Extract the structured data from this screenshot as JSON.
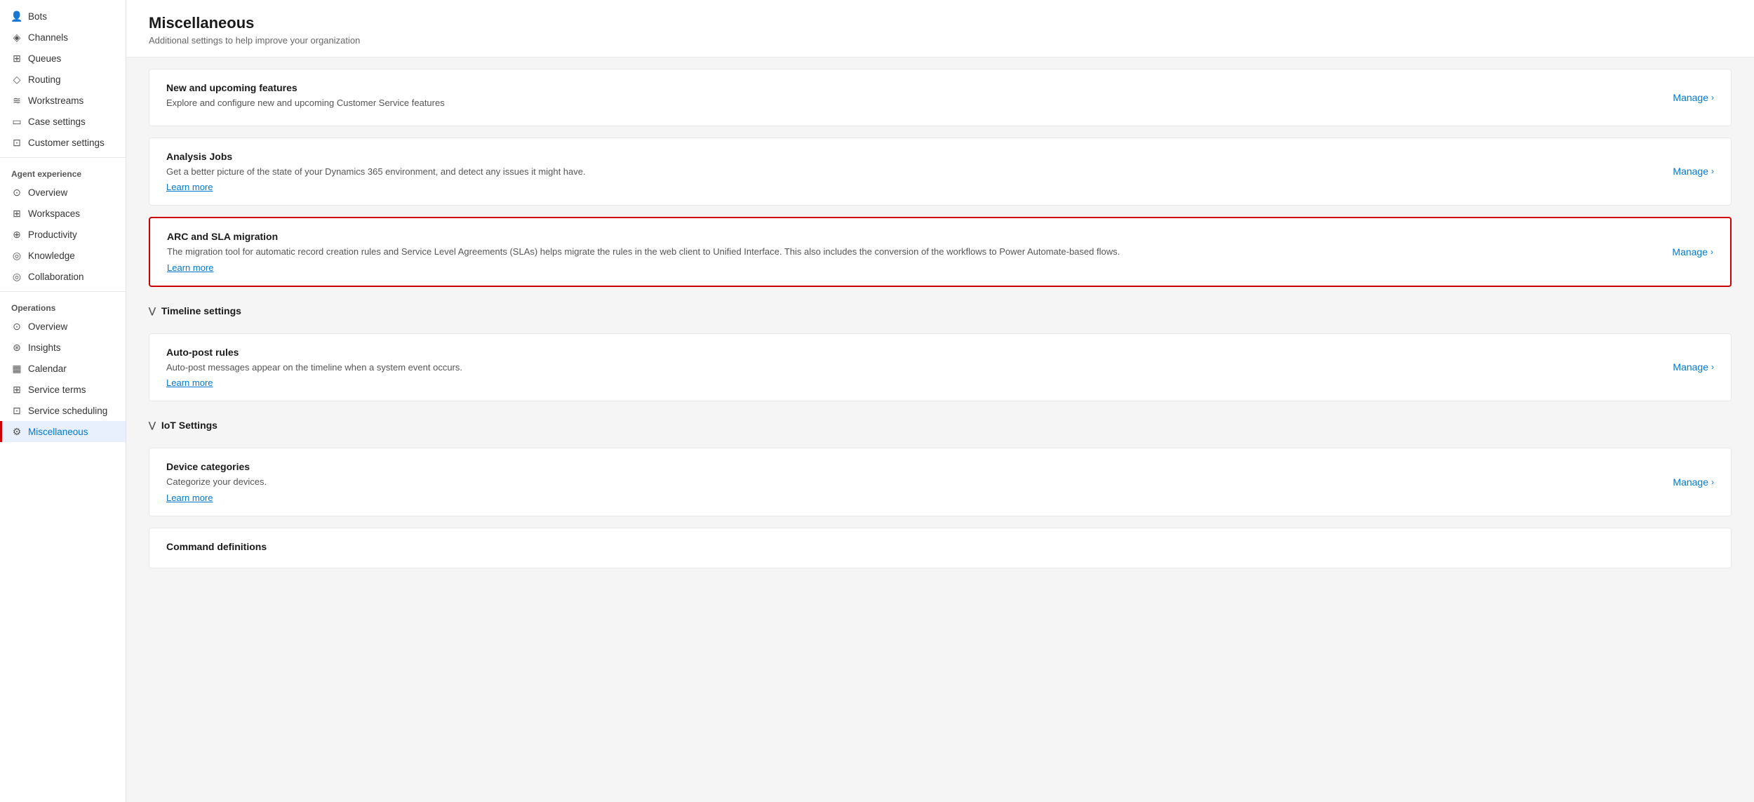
{
  "sidebar": {
    "sections": [
      {
        "name": "",
        "items": [
          {
            "id": "bots",
            "label": "Bots",
            "icon": "👤",
            "active": false
          },
          {
            "id": "channels",
            "label": "Channels",
            "icon": "◈",
            "active": false
          },
          {
            "id": "queues",
            "label": "Queues",
            "icon": "⊞",
            "active": false
          },
          {
            "id": "routing",
            "label": "Routing",
            "icon": "◇",
            "active": false
          },
          {
            "id": "workstreams",
            "label": "Workstreams",
            "icon": "≋",
            "active": false
          },
          {
            "id": "case-settings",
            "label": "Case settings",
            "icon": "▭",
            "active": false
          },
          {
            "id": "customer-settings",
            "label": "Customer settings",
            "icon": "⊡",
            "active": false
          }
        ]
      },
      {
        "name": "Agent experience",
        "items": [
          {
            "id": "ae-overview",
            "label": "Overview",
            "icon": "⊙",
            "active": false
          },
          {
            "id": "ae-workspaces",
            "label": "Workspaces",
            "icon": "⊞",
            "active": false
          },
          {
            "id": "ae-productivity",
            "label": "Productivity",
            "icon": "⊕",
            "active": false
          },
          {
            "id": "ae-knowledge",
            "label": "Knowledge",
            "icon": "◎",
            "active": false
          },
          {
            "id": "ae-collaboration",
            "label": "Collaboration",
            "icon": "◎",
            "active": false
          }
        ]
      },
      {
        "name": "Operations",
        "items": [
          {
            "id": "op-overview",
            "label": "Overview",
            "icon": "⊙",
            "active": false
          },
          {
            "id": "op-insights",
            "label": "Insights",
            "icon": "⊛",
            "active": false
          },
          {
            "id": "op-calendar",
            "label": "Calendar",
            "icon": "▦",
            "active": false
          },
          {
            "id": "op-service-terms",
            "label": "Service terms",
            "icon": "⊞",
            "active": false
          },
          {
            "id": "op-service-scheduling",
            "label": "Service scheduling",
            "icon": "⊡",
            "active": false
          },
          {
            "id": "op-miscellaneous",
            "label": "Miscellaneous",
            "icon": "⚙",
            "active": true
          }
        ]
      }
    ]
  },
  "page": {
    "title": "Miscellaneous",
    "subtitle": "Additional settings to help improve your organization"
  },
  "cards": [
    {
      "id": "new-features",
      "title": "New and upcoming features",
      "description": "Explore and configure new and upcoming Customer Service features",
      "link": null,
      "manage_label": "Manage",
      "highlighted": false
    },
    {
      "id": "analysis-jobs",
      "title": "Analysis Jobs",
      "description": "Get a better picture of the state of your Dynamics 365 environment, and detect any issues it might have.",
      "link": "Learn more",
      "manage_label": "Manage",
      "highlighted": false
    },
    {
      "id": "arc-sla",
      "title": "ARC and SLA migration",
      "description": "The migration tool for automatic record creation rules and Service Level Agreements (SLAs) helps migrate the rules in the web client to Unified Interface. This also includes the conversion of the workflows to Power Automate-based flows.",
      "link": "Learn more",
      "manage_label": "Manage",
      "highlighted": true
    }
  ],
  "sections": [
    {
      "id": "timeline",
      "label": "Timeline settings",
      "collapsed": false,
      "cards": [
        {
          "id": "auto-post",
          "title": "Auto-post rules",
          "description": "Auto-post messages appear on the timeline when a system event occurs.",
          "link": "Learn more",
          "manage_label": "Manage"
        }
      ]
    },
    {
      "id": "iot",
      "label": "IoT Settings",
      "collapsed": false,
      "cards": [
        {
          "id": "device-categories",
          "title": "Device categories",
          "description": "Categorize your devices.",
          "link": "Learn more",
          "manage_label": "Manage"
        }
      ]
    }
  ],
  "bottom_section": {
    "title": "Command definitions",
    "description": ""
  },
  "icons": {
    "chevron_right": "›",
    "chevron_down": "∨"
  }
}
